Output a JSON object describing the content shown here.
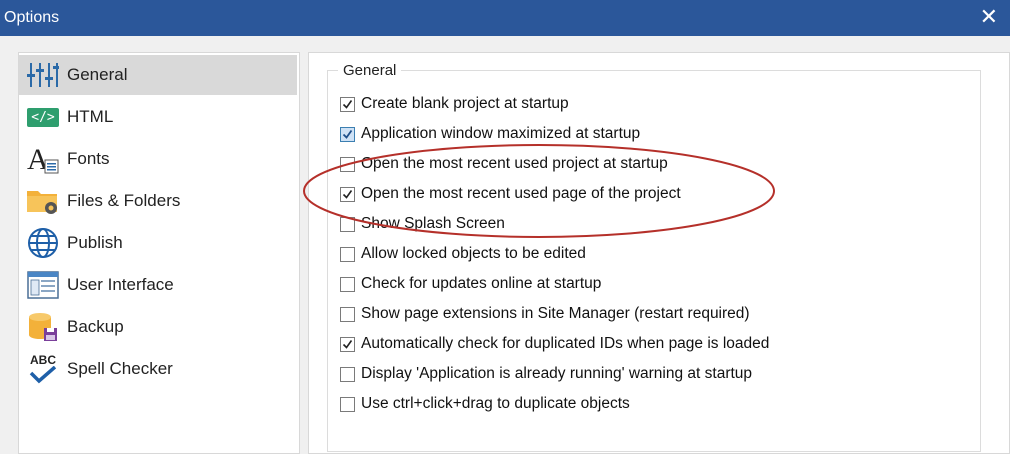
{
  "window": {
    "title": "Options",
    "close_glyph": "✕"
  },
  "sidebar": {
    "items": [
      {
        "label": "General",
        "icon": "sliders-icon",
        "selected": true
      },
      {
        "label": "HTML",
        "icon": "html-code-icon",
        "selected": false
      },
      {
        "label": "Fonts",
        "icon": "font-icon",
        "selected": false
      },
      {
        "label": "Files & Folders",
        "icon": "folder-gear-icon",
        "selected": false
      },
      {
        "label": "Publish",
        "icon": "globe-icon",
        "selected": false
      },
      {
        "label": "User Interface",
        "icon": "window-icon",
        "selected": false
      },
      {
        "label": "Backup",
        "icon": "database-save-icon",
        "selected": false
      },
      {
        "label": "Spell Checker",
        "icon": "spellcheck-icon",
        "selected": false
      }
    ],
    "html_badge": "</>",
    "spell_badge": "ABC"
  },
  "general": {
    "group_title": "General",
    "options": [
      {
        "label": "Create blank project at startup",
        "checked": true
      },
      {
        "label": "Application window maximized at startup",
        "checked": true
      },
      {
        "label": "Open the most recent used project at startup",
        "checked": false
      },
      {
        "label": "Open the most recent used page of the project",
        "checked": true
      },
      {
        "label": "Show Splash Screen",
        "checked": false
      },
      {
        "label": "Allow locked objects to be edited",
        "checked": false
      },
      {
        "label": "Check for updates online at startup",
        "checked": false
      },
      {
        "label": "Show page extensions in Site Manager (restart required)",
        "checked": false
      },
      {
        "label": "Automatically check for duplicated IDs when page is loaded",
        "checked": true
      },
      {
        "label": "Display 'Application is already running' warning at startup",
        "checked": false
      },
      {
        "label": "Use ctrl+click+drag to duplicate objects",
        "checked": false
      }
    ]
  },
  "colors": {
    "titlebar": "#2b579a",
    "selected_item": "#d9d9d9",
    "annotation": "#b5302a",
    "html_badge": "#2e9e6e"
  }
}
